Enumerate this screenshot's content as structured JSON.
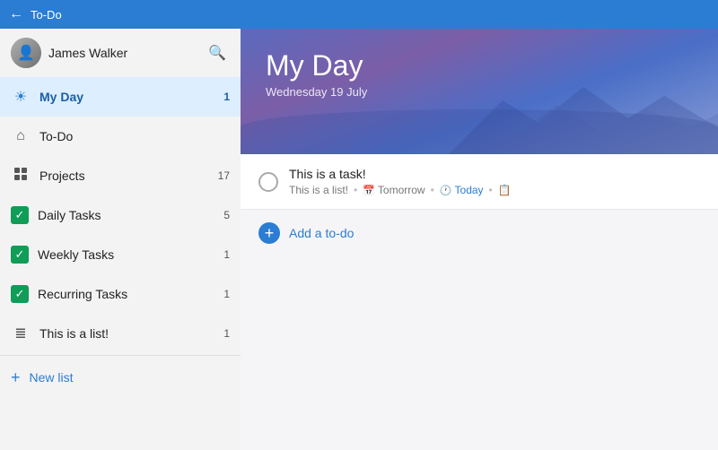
{
  "titleBar": {
    "backIcon": "←",
    "title": "To-Do"
  },
  "sidebar": {
    "user": {
      "name": "James Walker"
    },
    "searchIcon": "🔍",
    "items": [
      {
        "id": "my-day",
        "label": "My Day",
        "icon": "sun",
        "count": "1",
        "active": true
      },
      {
        "id": "to-do",
        "label": "To-Do",
        "icon": "home",
        "count": "",
        "active": false
      },
      {
        "id": "projects",
        "label": "Projects",
        "icon": "grid",
        "count": "17",
        "active": false
      },
      {
        "id": "daily-tasks",
        "label": "Daily Tasks",
        "icon": "check-green",
        "count": "5",
        "active": false
      },
      {
        "id": "weekly-tasks",
        "label": "Weekly Tasks",
        "icon": "check-green",
        "count": "1",
        "active": false
      },
      {
        "id": "recurring-tasks",
        "label": "Recurring Tasks",
        "icon": "check-green",
        "count": "1",
        "active": false
      },
      {
        "id": "this-is-a-list",
        "label": "This is a list!",
        "icon": "list",
        "count": "1",
        "active": false
      }
    ],
    "newList": "New list"
  },
  "content": {
    "hero": {
      "title": "My Day",
      "subtitle": "Wednesday 19 July"
    },
    "tasks": [
      {
        "title": "This is a task!",
        "list": "This is a list!",
        "due": "Tomorrow",
        "today": "Today",
        "hasNote": true
      }
    ],
    "addTodo": {
      "icon": "+",
      "label": "Add a to-do"
    }
  }
}
